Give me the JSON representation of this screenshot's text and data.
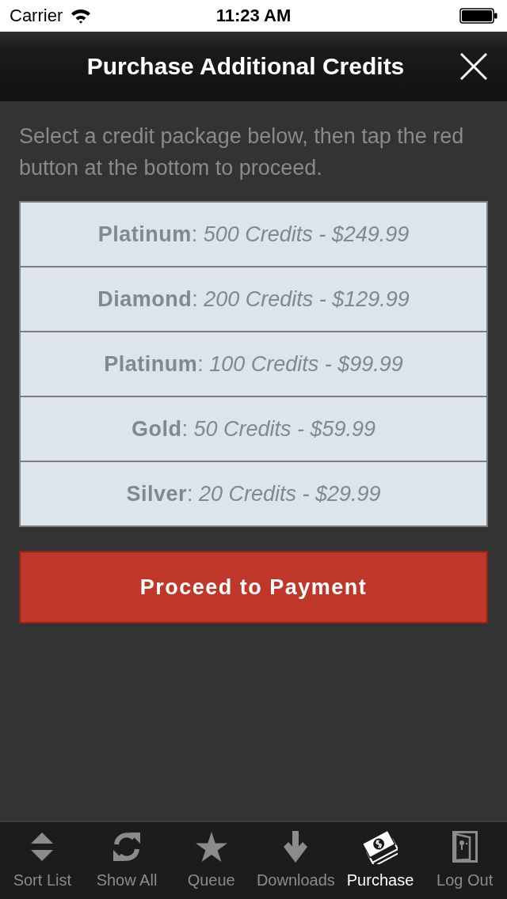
{
  "status_bar": {
    "carrier": "Carrier",
    "time": "11:23 AM"
  },
  "nav_bar": {
    "title": "Purchase Additional Credits"
  },
  "intro": "Select a credit package below, then tap the red button at the bottom to proceed.",
  "packages": [
    {
      "label": "**Platinum**: *500 Credits - $249.99*"
    },
    {
      "label": "**Diamond**: *200 Credits - $129.99*"
    },
    {
      "label": "**Platinum**: *100 Credits - $99.99*"
    },
    {
      "label": "**Gold**: *50 Credits - $59.99*"
    },
    {
      "label": "**Silver**: *20 Credits - $29.99*"
    }
  ],
  "proceed_button": {
    "label": "Proceed to Payment"
  },
  "tab_bar": {
    "items": [
      {
        "label": "Sort List",
        "selected": false
      },
      {
        "label": "Show All",
        "selected": false
      },
      {
        "label": "Queue",
        "selected": false
      },
      {
        "label": "Downloads",
        "selected": false
      },
      {
        "label": "Purchase",
        "selected": true
      },
      {
        "label": "Log Out",
        "selected": false
      }
    ]
  }
}
